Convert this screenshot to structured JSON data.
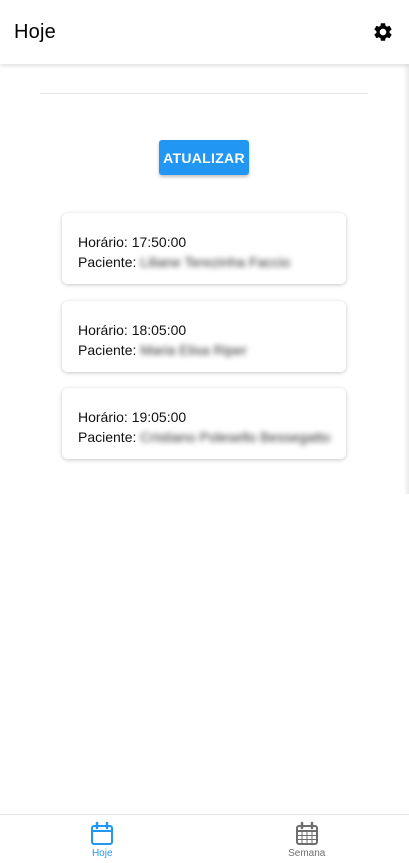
{
  "header": {
    "title": "Hoje",
    "settings_icon": "gear-icon"
  },
  "actions": {
    "refresh_label": "ATUALIZAR"
  },
  "appointments": [
    {
      "time_label": "Horário:",
      "time": "17:50:00",
      "patient_label": "Paciente:",
      "patient": "Liliane Terezinha Faccio"
    },
    {
      "time_label": "Horário:",
      "time": "18:05:00",
      "patient_label": "Paciente:",
      "patient": "Maria Elisa Riper"
    },
    {
      "time_label": "Horário:",
      "time": "19:05:00",
      "patient_label": "Paciente:",
      "patient": "Cristiano Polesello Bessegatto"
    }
  ],
  "bottom_nav": {
    "items": [
      {
        "label": "Hoje",
        "icon": "calendar-day-icon",
        "active": true
      },
      {
        "label": "Semana",
        "icon": "calendar-week-icon",
        "active": false
      }
    ]
  },
  "colors": {
    "accent": "#2196f3",
    "inactive": "#6e6e6e"
  }
}
